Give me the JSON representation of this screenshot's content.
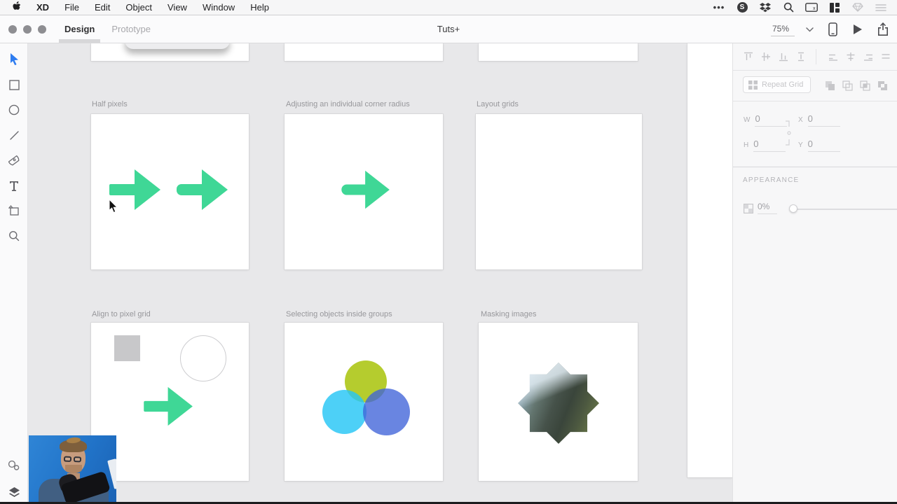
{
  "menu_bar": {
    "app": "XD",
    "menus": [
      "File",
      "Edit",
      "Object",
      "View",
      "Window",
      "Help"
    ],
    "status_icons": [
      "more-ellipsis",
      "skype",
      "dropbox",
      "spotlight-search",
      "input-source",
      "window-layout",
      "gem-disabled",
      "list-disabled"
    ],
    "skype_letter": "S"
  },
  "toolbar": {
    "tabs": [
      {
        "label": "Design",
        "active": true
      },
      {
        "label": "Prototype",
        "active": false
      }
    ],
    "title": "Tuts+",
    "zoom_level": "75%"
  },
  "tool_sidebar": {
    "tools": [
      "select",
      "rectangle",
      "ellipse",
      "line",
      "pen",
      "text",
      "artboard",
      "zoom"
    ],
    "bottom_tools": [
      "assets",
      "layers"
    ]
  },
  "canvas": {
    "artboards": [
      {
        "label": "Half pixels"
      },
      {
        "label": "Adjusting an individual corner radius"
      },
      {
        "label": "Layout grids"
      },
      {
        "label": "Align to pixel grid"
      },
      {
        "label": "Selecting objects inside groups"
      },
      {
        "label": "Masking images"
      }
    ]
  },
  "right_panel": {
    "repeat_grid_label": "Repeat Grid",
    "transform": {
      "w_label": "W",
      "w_value": "0",
      "h_label": "H",
      "h_value": "0",
      "x_label": "X",
      "x_value": "0",
      "y_label": "Y",
      "y_value": "0"
    },
    "appearance": {
      "title": "APPEARANCE",
      "opacity": "0%"
    }
  },
  "colors": {
    "arrow_green": "#3fd796",
    "circle_yellow": "#b5cc2e",
    "circle_cyan": "#26c6f5",
    "circle_blue": "#3f63d9",
    "select_blue": "#2e7cf0",
    "webcam_blue": "#2579cd"
  }
}
